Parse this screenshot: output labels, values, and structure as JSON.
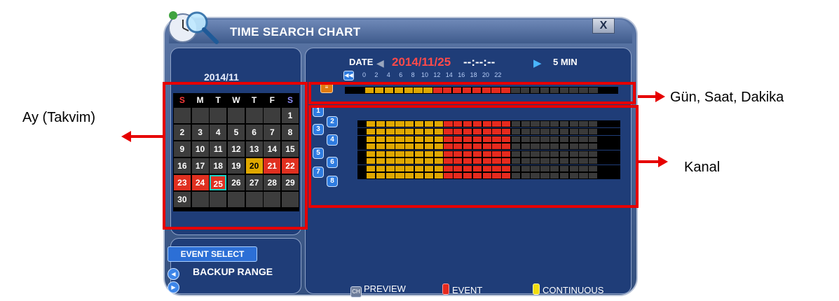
{
  "window": {
    "title": "TIME SEARCH CHART",
    "close_label": "X"
  },
  "calendar": {
    "month": "2014/11",
    "weekdays": [
      "S",
      "M",
      "T",
      "W",
      "T",
      "F",
      "S"
    ],
    "weeks": [
      [
        "",
        "",
        "",
        "",
        "",
        "",
        "1"
      ],
      [
        "2",
        "3",
        "4",
        "5",
        "6",
        "7",
        "8"
      ],
      [
        "9",
        "10",
        "11",
        "12",
        "13",
        "14",
        "15"
      ],
      [
        "16",
        "17",
        "18",
        "19",
        "20",
        "21",
        "22"
      ],
      [
        "23",
        "24",
        "25",
        "26",
        "27",
        "28",
        "29"
      ],
      [
        "30",
        "",
        "",
        "",
        "",
        "",
        ""
      ]
    ],
    "continuous_days": [
      "20"
    ],
    "event_days": [
      "21",
      "22",
      "23",
      "24"
    ],
    "selected_day": "25"
  },
  "controls": {
    "event_select": "EVENT SELECT",
    "backup_range": "BACKUP RANGE"
  },
  "header": {
    "date_label": "DATE",
    "date": "2014/11/25",
    "time": "--:--:--",
    "interval": "5 MIN"
  },
  "hours": [
    "0",
    "2",
    "4",
    "6",
    "8",
    "10",
    "12",
    "14",
    "16",
    "18",
    "20",
    "22"
  ],
  "channels": [
    "1",
    "2",
    "3",
    "4",
    "5",
    "6",
    "7",
    "8"
  ],
  "legend": {
    "preview_icon": "CH",
    "preview": "PREVIEW",
    "event": "EVENT",
    "continuous": "CONTINUOUS"
  },
  "colors": {
    "continuous": "#e0a800",
    "event": "#e62a1e",
    "empty": "#3a3a3a"
  },
  "annotations": {
    "calendar": "Ay  (Takvim)",
    "timeline": "Gün,  Saat,  Dakika",
    "channel": "Kanal"
  }
}
